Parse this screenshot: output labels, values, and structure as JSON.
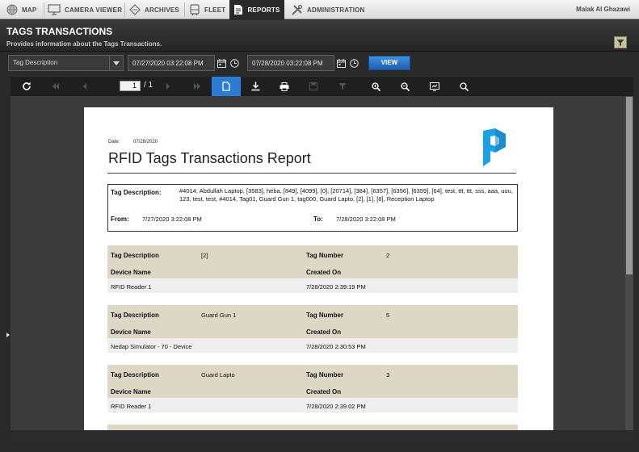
{
  "nav": {
    "items": [
      {
        "label": "MAP",
        "icon": "globe-icon"
      },
      {
        "label": "CAMERA VIEWER",
        "icon": "monitor-icon"
      },
      {
        "label": "ARCHIVES",
        "icon": "archive-diamond-icon"
      },
      {
        "label": "FLEET",
        "icon": "bus-icon"
      },
      {
        "label": "REPORTS",
        "icon": "report-document-icon"
      },
      {
        "label": "ADMINISTRATION",
        "icon": "tools-icon"
      }
    ],
    "active": "REPORTS",
    "user": "Malak Al Ghazawi"
  },
  "header": {
    "title": "TAGS TRANSACTIONS",
    "subtitle": "Provides information about the Tags Transactions.",
    "filter_icon": "filter-icon"
  },
  "params": {
    "select_value": "Tag Description",
    "from_datetime": "07/27/2020 03:22:08 PM",
    "to_datetime": "07/28/2020 03:22:08 PM",
    "view_label": "VIEW"
  },
  "viewer": {
    "current_page": "1",
    "total_pages": "/ 1",
    "tools": [
      "refresh-icon",
      "first-page-icon",
      "previous-page-icon",
      "next-page-icon",
      "last-page-icon",
      "single-page-icon",
      "download-icon",
      "print-icon",
      "save-icon",
      "filter-icon",
      "zoom-in-icon",
      "zoom-out-icon",
      "fit-page-icon",
      "search-icon"
    ],
    "active_tool": "single-page-icon"
  },
  "report": {
    "date_label": "Date:",
    "date": "07/28/2020",
    "title": "RFID Tags Transactions Report",
    "tag_desc_label": "Tag Description:",
    "tag_desc_value": "#4014, Abdullah Laptop, [3583], heba, [849], [4099], [0], [20714], [384], [6357], [6356], [6359], [64], test, ttt, ttt, sss, aaa, uuu, 123, test, test, #4014, Tag01, Guard Gun 1, tag000, Guard Lapto, [2], [1], [8], Reception Laptop",
    "from_label": "From:",
    "from_value": "7/27/2020 3:22:08 PM",
    "to_label": "To:",
    "to_value": "7/28/2020 3:22:08 PM",
    "col_tag_desc": "Tag Description",
    "col_tag_number": "Tag Number",
    "col_device_name": "Device Name",
    "col_created_on": "Created On",
    "records": [
      {
        "tag_description": "[2]",
        "tag_number": "2",
        "device_name": "RFID Reader 1",
        "created_on": "7/28/2020 2:39:19 PM"
      },
      {
        "tag_description": "Guard Gun 1",
        "tag_number": "5",
        "device_name": "Nedap Simulator - 70 - Device",
        "created_on": "7/28/2020 2:30:53 PM"
      },
      {
        "tag_description": "Guard Lapto",
        "tag_number": "3",
        "device_name": "RFID Reader 1",
        "created_on": "7/28/2020 2:39:02 PM"
      }
    ]
  },
  "colors": {
    "accent_blue": "#2c7bd4",
    "record_header": "#dcd8c5",
    "record_row": "#efefef",
    "logo_blue": "#1ca0e6"
  }
}
